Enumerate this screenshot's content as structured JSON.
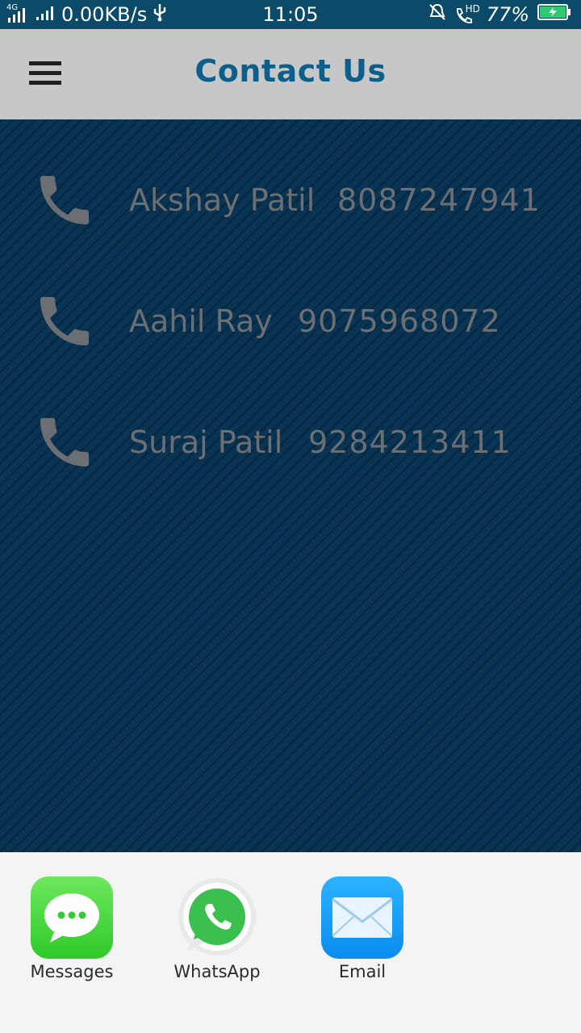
{
  "status_bar": {
    "network_type": "4G",
    "data_speed": "0.00KB/s",
    "time": "11:05",
    "hd_badge": "HD",
    "battery_percent": "77%",
    "battery_level": 0.77,
    "icons": [
      "signal-icon",
      "usb-icon",
      "muted-bell-icon",
      "hd-call-icon",
      "battery-icon"
    ]
  },
  "app_bar": {
    "title": "Contact Us",
    "menu_icon": "hamburger-icon"
  },
  "contacts": [
    {
      "name": "Akshay Patil",
      "phone": "8087247941",
      "icon": "phone-icon"
    },
    {
      "name": "Aahil Ray",
      "phone": "9075968072",
      "icon": "phone-icon"
    },
    {
      "name": "Suraj Patil",
      "phone": "9284213411",
      "icon": "phone-icon"
    }
  ],
  "share_sheet": {
    "apps": [
      {
        "label": "Messages",
        "icon": "messages-icon"
      },
      {
        "label": "WhatsApp",
        "icon": "whatsapp-icon"
      },
      {
        "label": "Email",
        "icon": "email-icon"
      }
    ]
  },
  "colors": {
    "status_bar": "#0b4a68",
    "app_bar": "#c7c7c7",
    "title": "#0b5f8a",
    "content_bg": "#052a45",
    "contact_text": "#6b6f73",
    "sheet_bg": "#f4f4f4"
  }
}
